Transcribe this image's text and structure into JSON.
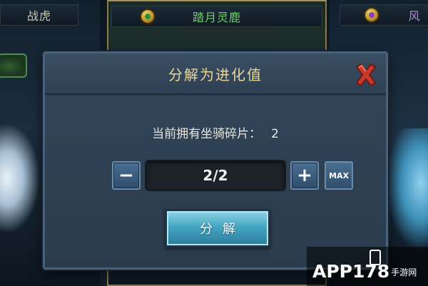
{
  "background": {
    "left_card_title": "战虎",
    "center_card_title": "踏月灵鹿",
    "right_card_title": "风"
  },
  "dialog": {
    "title": "分解为进化值",
    "owned_label": "当前拥有坐骑碎片：",
    "owned_count": "2",
    "quantity_display": "2/2",
    "minus_label": "−",
    "plus_label": "+",
    "max_label": "MAX",
    "decompose_label": "分解"
  },
  "watermark": {
    "brand": "APP178",
    "suffix": "手游网"
  },
  "colors": {
    "title_gold": "#e9d79a",
    "close_red": "#c8392b",
    "button_cyan": "#45a5c2",
    "stepper_blue": "#3a5d80"
  }
}
